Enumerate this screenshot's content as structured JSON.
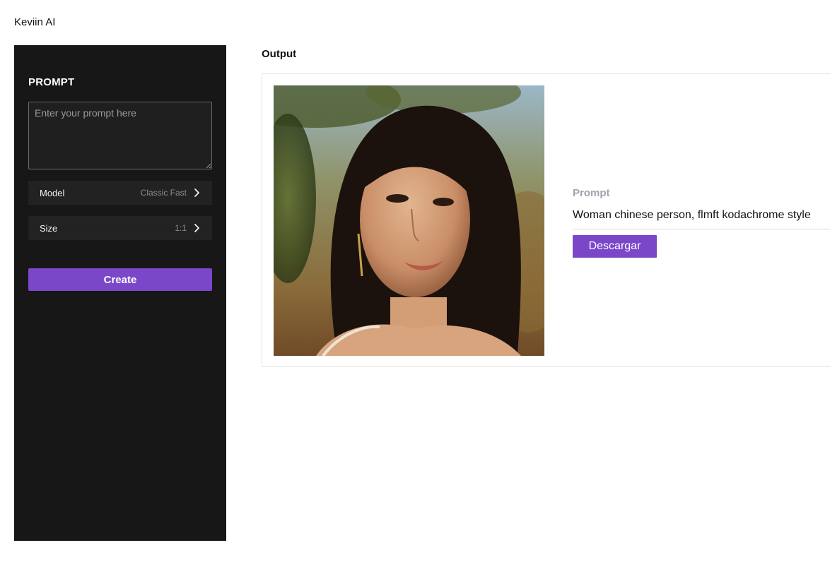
{
  "app": {
    "title": "Keviin AI"
  },
  "sidebar": {
    "prompt_heading": "PROMPT",
    "prompt_placeholder": "Enter your prompt here",
    "prompt_value": "",
    "settings": [
      {
        "label": "Model",
        "value": "Classic Fast",
        "icon": "chevron-right-icon"
      },
      {
        "label": "Size",
        "value": "1:1",
        "icon": "chevron-right-icon"
      }
    ],
    "create_label": "Create",
    "background_color": "#171717",
    "accent_color": "#7b47c9"
  },
  "output": {
    "heading": "Output",
    "image_alt": "Woman chinese person, flmft kodachrome style",
    "prompt_label": "Prompt",
    "prompt_text": "Woman chinese person, flmft kodachrome style",
    "download_label": "Descargar",
    "accent_color": "#7b47c9"
  }
}
